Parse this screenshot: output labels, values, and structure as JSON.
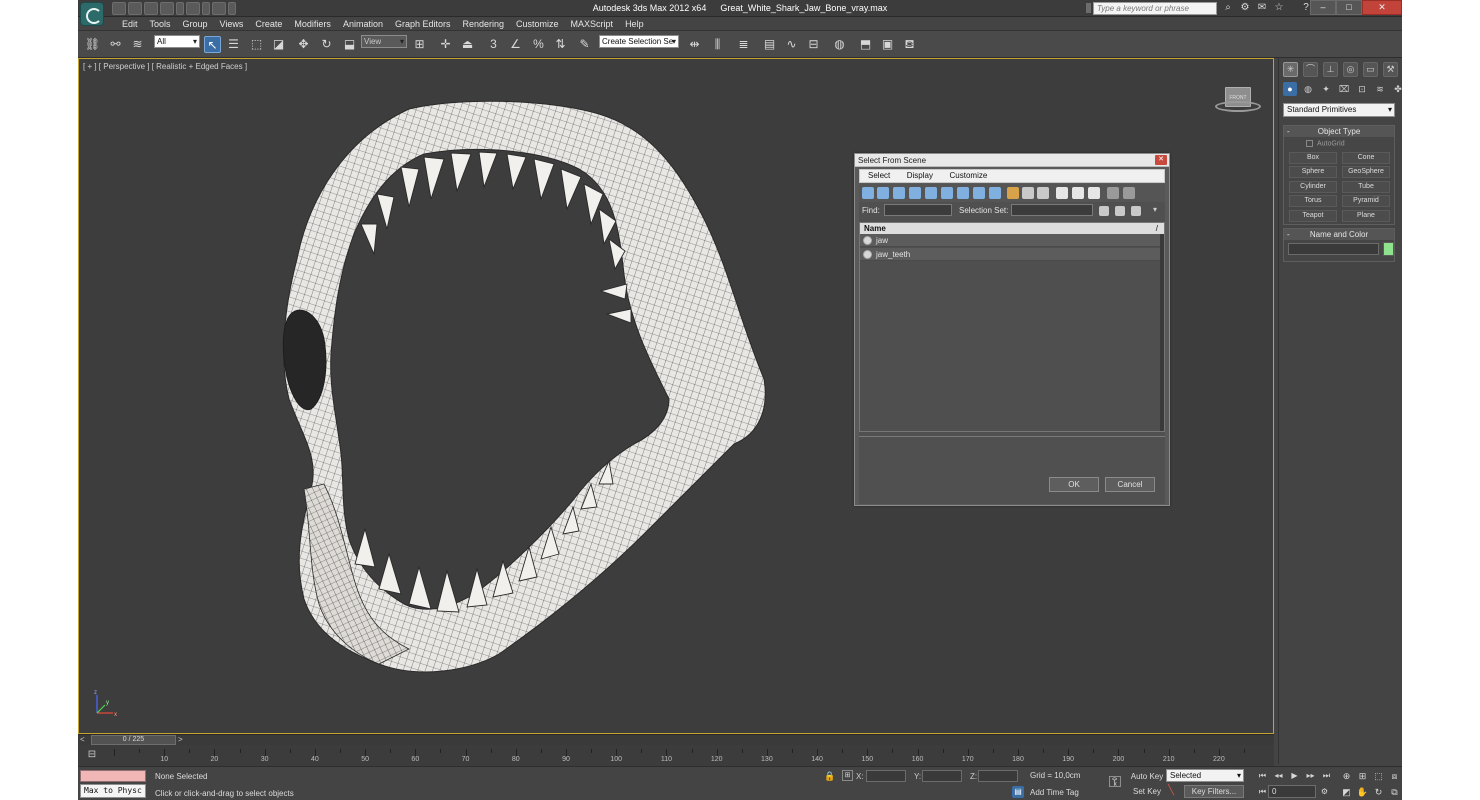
{
  "titlebar": {
    "app_title": "Autodesk 3ds Max 2012 x64",
    "file_name": "Great_White_Shark_Jaw_Bone_vray.max",
    "search_placeholder": "Type a keyword or phrase",
    "win_minimize": "–",
    "win_maximize": "□",
    "win_close": "✕"
  },
  "menu": [
    "Edit",
    "Tools",
    "Group",
    "Views",
    "Create",
    "Modifiers",
    "Animation",
    "Graph Editors",
    "Rendering",
    "Customize",
    "MAXScript",
    "Help"
  ],
  "toolbar": {
    "selection_filter": "All",
    "reference_coord": "View",
    "named_selection": "Create Selection Se",
    "angle_snap_label": "3"
  },
  "viewport": {
    "label": "[ + ] [ Perspective ] [ Realistic + Edged Faces ]",
    "viewcube_label": "FRONT",
    "axis_x": "x",
    "axis_y": "y",
    "axis_z": "z"
  },
  "dialog": {
    "title": "Select From Scene",
    "close": "✕",
    "menu": [
      "Select",
      "Display",
      "Customize"
    ],
    "find_label": "Find:",
    "selection_set_label": "Selection Set:",
    "column_header": "Name",
    "column_sort": "/",
    "objects": [
      "jaw",
      "jaw_teeth"
    ],
    "ok_label": "OK",
    "cancel_label": "Cancel"
  },
  "command_panel": {
    "category": "Standard Primitives",
    "object_type_header": "Object Type",
    "autogrid_label": "AutoGrid",
    "primitives": [
      "Box",
      "Cone",
      "Sphere",
      "GeoSphere",
      "Cylinder",
      "Tube",
      "Torus",
      "Pyramid",
      "Teapot",
      "Plane"
    ],
    "name_color_header": "Name and Color",
    "object_color": "#8fe38c"
  },
  "timeline": {
    "left_arrow": "<",
    "right_arrow": ">",
    "frame_display": "0 / 225",
    "ticks": [
      10,
      20,
      30,
      40,
      50,
      60,
      70,
      80,
      90,
      100,
      110,
      120,
      130,
      140,
      150,
      160,
      170,
      180,
      190,
      200,
      210,
      220
    ]
  },
  "status": {
    "script_listener": "Max to Physc",
    "selection_status": "None Selected",
    "prompt": "Click or click-and-drag to select objects",
    "x_label": "X:",
    "y_label": "Y:",
    "z_label": "Z:",
    "grid": "Grid = 10,0cm",
    "add_time_tag": "Add Time Tag",
    "auto_key": "Auto Key",
    "set_key": "Set Key",
    "key_mode": "Selected",
    "key_filters": "Key Filters...",
    "current_frame": "0"
  }
}
